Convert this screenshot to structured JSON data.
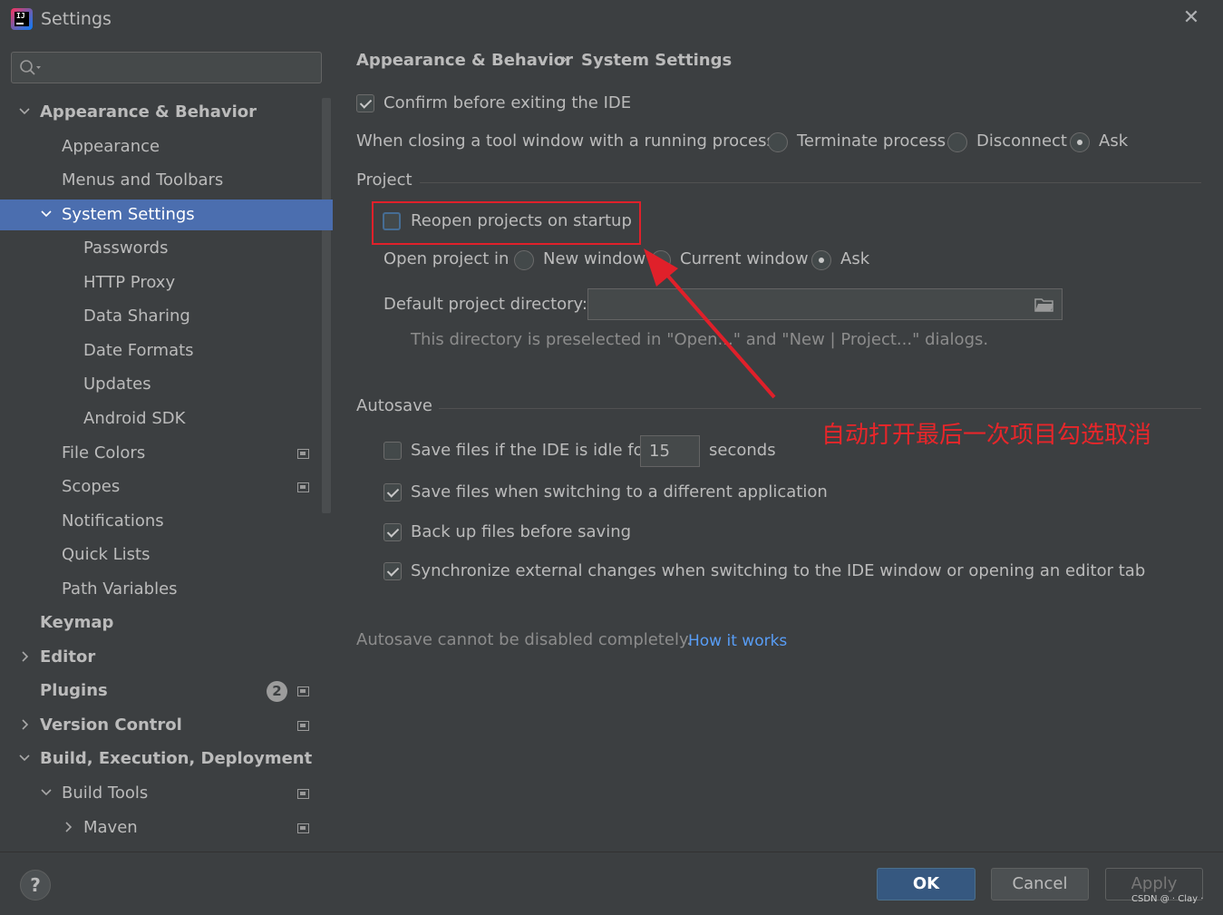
{
  "window": {
    "title": "Settings",
    "close": "✕",
    "logo_text": "IJ"
  },
  "search": {
    "placeholder": "",
    "value": ""
  },
  "sidebar": {
    "items": [
      {
        "label": "Appearance & Behavior",
        "level": 0,
        "bold": true,
        "chevron": "down"
      },
      {
        "label": "Appearance",
        "level": 1
      },
      {
        "label": "Menus and Toolbars",
        "level": 1
      },
      {
        "label": "System Settings",
        "level": 1,
        "chevron": "down",
        "selected": true
      },
      {
        "label": "Passwords",
        "level": 2
      },
      {
        "label": "HTTP Proxy",
        "level": 2
      },
      {
        "label": "Data Sharing",
        "level": 2
      },
      {
        "label": "Date Formats",
        "level": 2
      },
      {
        "label": "Updates",
        "level": 2
      },
      {
        "label": "Android SDK",
        "level": 2
      },
      {
        "label": "File Colors",
        "level": 1,
        "project_icon": true
      },
      {
        "label": "Scopes",
        "level": 1,
        "project_icon": true
      },
      {
        "label": "Notifications",
        "level": 1
      },
      {
        "label": "Quick Lists",
        "level": 1
      },
      {
        "label": "Path Variables",
        "level": 1
      },
      {
        "label": "Keymap",
        "level": 0,
        "bold": true
      },
      {
        "label": "Editor",
        "level": 0,
        "bold": true,
        "chevron": "right"
      },
      {
        "label": "Plugins",
        "level": 0,
        "bold": true,
        "badge": "2",
        "project_icon": true
      },
      {
        "label": "Version Control",
        "level": 0,
        "bold": true,
        "chevron": "right",
        "project_icon": true
      },
      {
        "label": "Build, Execution, Deployment",
        "level": 0,
        "bold": true,
        "chevron": "down"
      },
      {
        "label": "Build Tools",
        "level": 1,
        "chevron": "down",
        "project_icon": true
      },
      {
        "label": "Maven",
        "level": 2,
        "chevron": "right",
        "project_icon": true
      }
    ]
  },
  "breadcrumb": {
    "parent": "Appearance & Behavior",
    "separator": "›",
    "current": "System Settings"
  },
  "general": {
    "confirm_exit": {
      "label": "Confirm before exiting the IDE",
      "checked": true
    },
    "closing_label": "When closing a tool window with a running process:",
    "closing_options": [
      {
        "label": "Terminate process",
        "checked": false
      },
      {
        "label": "Disconnect",
        "checked": false
      },
      {
        "label": "Ask",
        "checked": true
      }
    ]
  },
  "project": {
    "section_title": "Project",
    "reopen": {
      "label": "Reopen projects on startup",
      "checked": false
    },
    "open_in_label": "Open project in",
    "open_in_options": [
      {
        "label": "New window",
        "checked": false
      },
      {
        "label": "Current window",
        "checked": false
      },
      {
        "label": "Ask",
        "checked": true
      }
    ],
    "default_dir_label": "Default project directory:",
    "default_dir_value": "",
    "default_dir_hint": "This directory is preselected in \"Open...\" and \"New | Project...\" dialogs."
  },
  "autosave": {
    "section_title": "Autosave",
    "idle": {
      "label": "Save files if the IDE is idle for",
      "checked": false,
      "value": "15",
      "unit": "seconds"
    },
    "options": [
      {
        "label": "Save files when switching to a different application",
        "checked": true
      },
      {
        "label": "Back up files before saving",
        "checked": true
      },
      {
        "label": "Synchronize external changes when switching to the IDE window or opening an editor tab",
        "checked": true
      }
    ],
    "note": "Autosave cannot be disabled completely.",
    "link": "How it works"
  },
  "footer": {
    "help": "?",
    "ok": "OK",
    "cancel": "Cancel",
    "apply": "Apply",
    "watermark": "CSDN @ · Clay ·"
  },
  "annotation": {
    "text": "自动打开最后一次项目勾选取消",
    "color": "#e0202a"
  },
  "colors": {
    "background": "#3c3f41",
    "selection": "#4b6eaf",
    "primary_button": "#365880",
    "link": "#589df6"
  }
}
